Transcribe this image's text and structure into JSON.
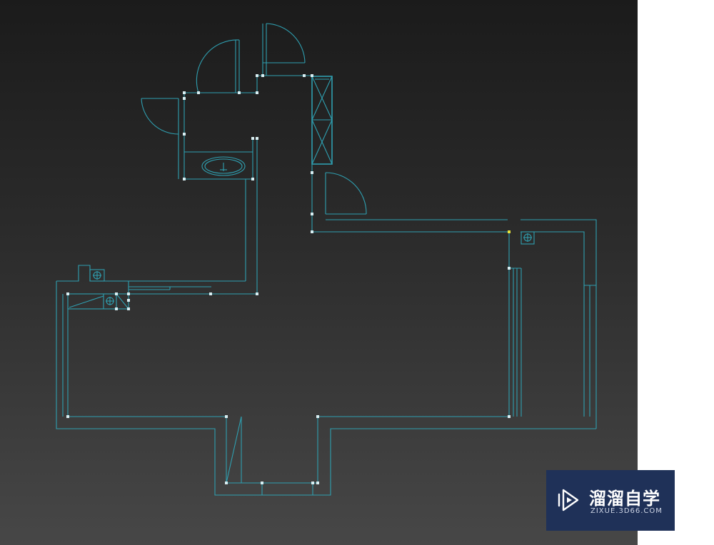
{
  "viewport": {
    "name": "3d-viewport",
    "background_top": "#1b1b1b",
    "background_bottom": "#474747",
    "line_color": "#2f9fb0",
    "vertex_color": "#d9eef2",
    "selected_vertex_color": "#e7e23a"
  },
  "floor_plan": {
    "icons": [
      "door-swing-icon",
      "sink-icon",
      "wardrobe-icon",
      "outlet-icon"
    ]
  },
  "watermark": {
    "brand_cn": "溜溜自学",
    "brand_url": "ZIXUE.3D66.COM",
    "icon": "play-logo-icon",
    "background": "#1f3158"
  }
}
